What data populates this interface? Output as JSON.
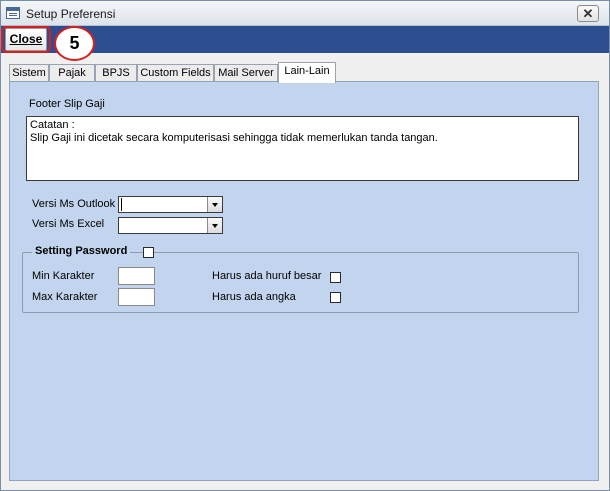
{
  "window": {
    "title": "Setup Preferensi",
    "close_glyph": "✕"
  },
  "toolbar": {
    "close_label": "Close",
    "annotation_number": "5",
    "annotation_color": "#d62020"
  },
  "tabs": [
    {
      "label": "Sistem",
      "active": false
    },
    {
      "label": "Pajak",
      "active": false
    },
    {
      "label": "BPJS",
      "active": false
    },
    {
      "label": "Custom Fields",
      "active": false
    },
    {
      "label": "Mail Server",
      "active": false
    },
    {
      "label": "Lain-Lain",
      "active": true
    }
  ],
  "footer": {
    "label": "Footer Slip Gaji",
    "line1": "Catatan :",
    "line2": "Slip Gaji ini dicetak secara komputerisasi sehingga tidak memerlukan tanda tangan."
  },
  "versions": {
    "outlook_label": "Versi Ms Outlook",
    "outlook_value": "",
    "excel_label": "Versi Ms Excel",
    "excel_value": ""
  },
  "password": {
    "title": "Setting Password",
    "enabled": false,
    "min_label": "Min Karakter",
    "min_value": "",
    "max_label": "Max Karakter",
    "max_value": "",
    "uppercase_label": "Harus ada huruf besar",
    "uppercase_checked": false,
    "number_label": "Harus ada angka",
    "number_checked": false
  },
  "colors": {
    "toolbar": "#2d4f8f",
    "panel": "#c3d5ee"
  }
}
